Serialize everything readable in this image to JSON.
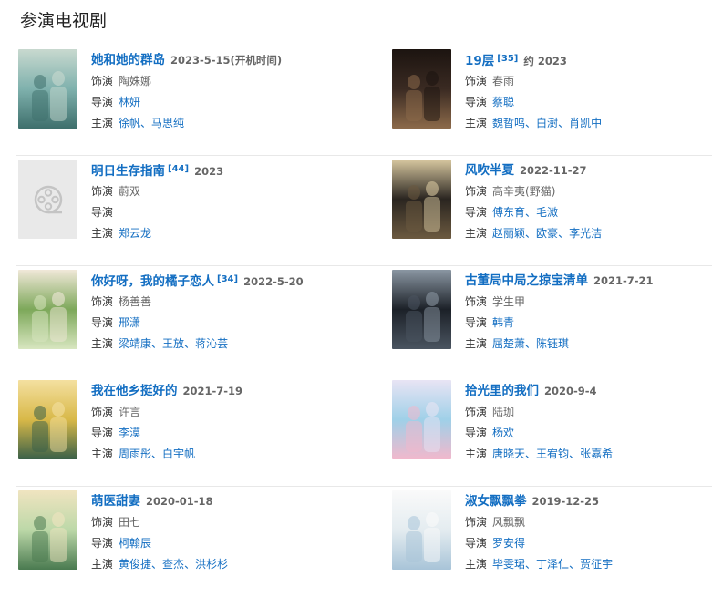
{
  "section_title": "参演电视剧",
  "labels": {
    "role": "饰演",
    "director": "导演",
    "cast": "主演"
  },
  "dramas": [
    {
      "title": "她和她的群岛",
      "ref": "",
      "date": "2023-5-15(开机时间)",
      "role": "陶姝娜",
      "director": [
        "林妍"
      ],
      "cast": [
        "徐帆",
        "马思纯"
      ],
      "poster": {
        "colors": [
          "#7fb1ad",
          "#3e6f6c",
          "#c8d9cf"
        ]
      }
    },
    {
      "title": "19层",
      "ref": "[35]",
      "date": "约 2023",
      "role": "春雨",
      "director": [
        "蔡聪"
      ],
      "cast": [
        "魏晢鸣",
        "白澍",
        "肖凯中"
      ],
      "poster": {
        "colors": [
          "#3a2a22",
          "#8c6a4a",
          "#1c1410"
        ]
      }
    },
    {
      "title": "明日生存指南",
      "ref": "[44]",
      "date": "2023",
      "role": "蔚双",
      "director": [],
      "cast": [
        "郑云龙"
      ],
      "poster": {
        "placeholder": true
      }
    },
    {
      "title": "风吹半夏",
      "ref": "",
      "date": "2022-11-27",
      "role": "高辛夷(野猫)",
      "director": [
        "傅东育",
        "毛溦"
      ],
      "cast": [
        "赵丽颖",
        "欧豪",
        "李光洁"
      ],
      "poster": {
        "colors": [
          "#2a2520",
          "#6c5a40",
          "#d8c8a0"
        ]
      }
    },
    {
      "title": "你好呀，我的橘子恋人",
      "ref": "[34]",
      "date": "2022-5-20",
      "role": "杨善善",
      "director": [
        "邢潇"
      ],
      "cast": [
        "梁靖康",
        "王放",
        "蒋沁芸"
      ],
      "poster": {
        "colors": [
          "#7da85a",
          "#d8e6c0",
          "#f0e8d8"
        ]
      }
    },
    {
      "title": "古董局中局之掠宝清单",
      "ref": "",
      "date": "2021-7-21",
      "role": "学生甲",
      "director": [
        "韩青"
      ],
      "cast": [
        "屈楚萧",
        "陈钰琪"
      ],
      "poster": {
        "colors": [
          "#1c2128",
          "#4a5460",
          "#8a96a2"
        ]
      }
    },
    {
      "title": "我在他乡挺好的",
      "ref": "",
      "date": "2021-7-19",
      "role": "许言",
      "director": [
        "李漠"
      ],
      "cast": [
        "周雨彤",
        "白宇帆"
      ],
      "poster": {
        "colors": [
          "#d8b848",
          "#3a6048",
          "#f4e0a0"
        ]
      }
    },
    {
      "title": "拾光里的我们",
      "ref": "",
      "date": "2020-9-4",
      "role": "陆珈",
      "director": [
        "杨欢"
      ],
      "cast": [
        "唐晓天",
        "王宥钧",
        "张嘉希"
      ],
      "poster": {
        "colors": [
          "#9fd0e8",
          "#f2b8cc",
          "#e8e4f4"
        ]
      }
    },
    {
      "title": "萌医甜妻",
      "ref": "",
      "date": "2020-01-18",
      "role": "田七",
      "director": [
        "柯翰辰"
      ],
      "cast": [
        "黄俊捷",
        "查杰",
        "洪杉杉"
      ],
      "poster": {
        "colors": [
          "#bcd8a8",
          "#4a7a50",
          "#f0e4c0"
        ]
      }
    },
    {
      "title": "淑女飘飘拳",
      "ref": "",
      "date": "2019-12-25",
      "role": "风飘飘",
      "director": [
        "罗安得"
      ],
      "cast": [
        "毕雯珺",
        "丁泽仁",
        "贾征宇"
      ],
      "poster": {
        "colors": [
          "#e4ecf0",
          "#a8c4d8",
          "#fafafa"
        ]
      }
    }
  ]
}
